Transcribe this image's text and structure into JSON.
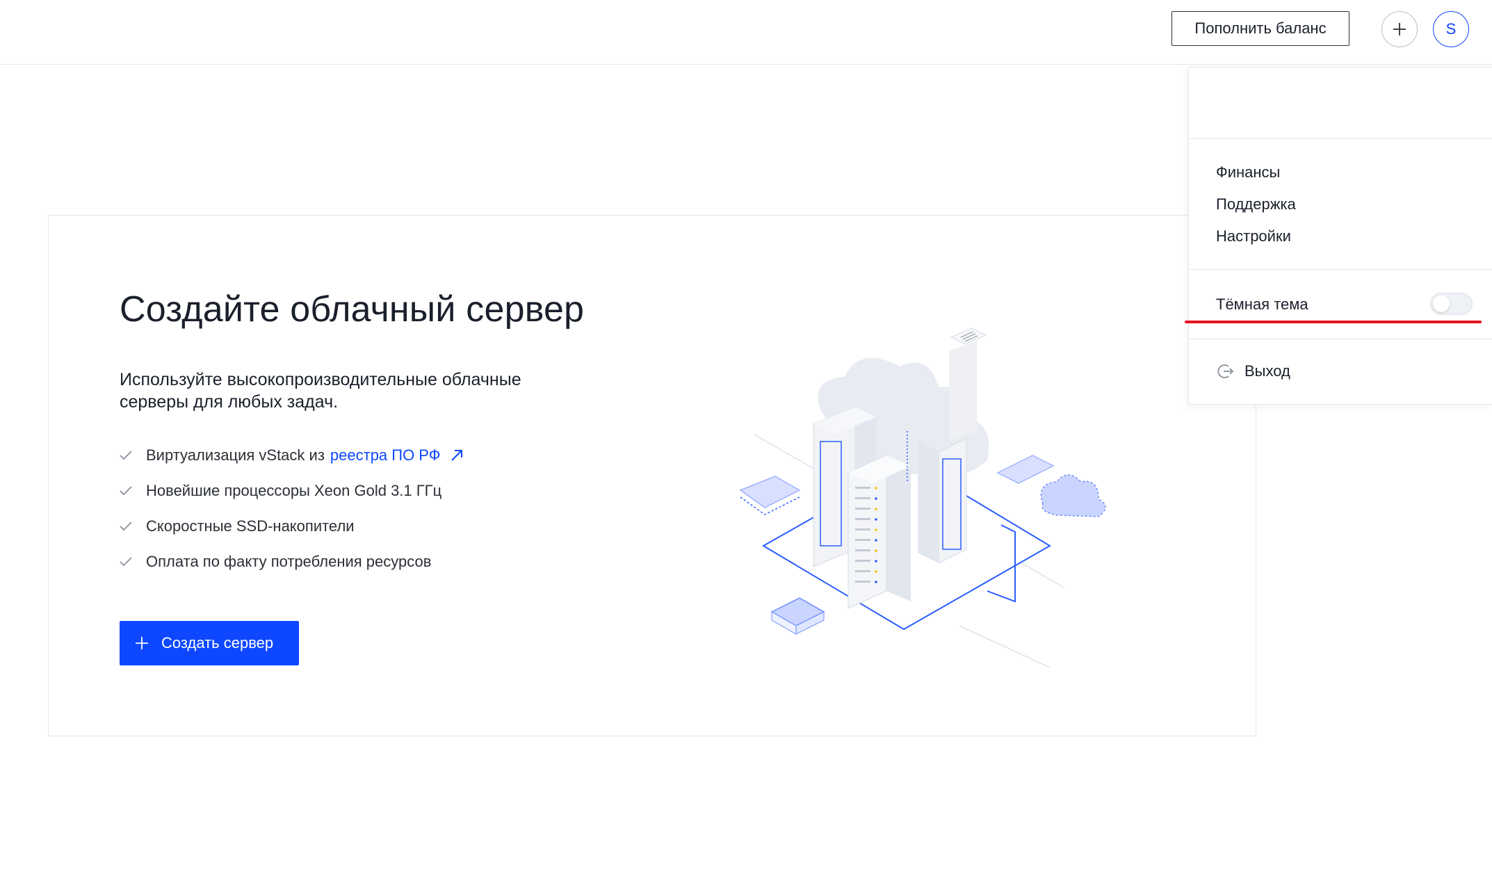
{
  "header": {
    "topup_label": "Пополнить баланс",
    "avatar_initial": "S"
  },
  "hero": {
    "title": "Создайте облачный сервер",
    "subtitle": "Используйте высокопроизводительные облачные серверы для любых задач.",
    "features": [
      {
        "text": "Виртуализация vStack из",
        "link": "реестра ПО РФ"
      },
      {
        "text": "Новейшие процессоры Xeon Gold 3.1 ГГц"
      },
      {
        "text": "Скоростные SSD-накопители"
      },
      {
        "text": "Оплата по факту потребления ресурсов"
      }
    ],
    "create_button_label": "Создать сервер"
  },
  "user_menu": {
    "items": [
      {
        "label": "Финансы"
      },
      {
        "label": "Поддержка"
      },
      {
        "label": "Настройки"
      }
    ],
    "dark_theme_label": "Тёмная тема",
    "dark_theme_enabled": false,
    "logout_label": "Выход"
  },
  "colors": {
    "accent": "#0d47ff",
    "highlight": "#e8131f",
    "border": "#e3e6ea",
    "text": "#1a1f2b"
  },
  "icons": {
    "add": "plus-icon",
    "external": "arrow-up-right-icon",
    "check": "check-icon",
    "logout": "logout-icon"
  }
}
